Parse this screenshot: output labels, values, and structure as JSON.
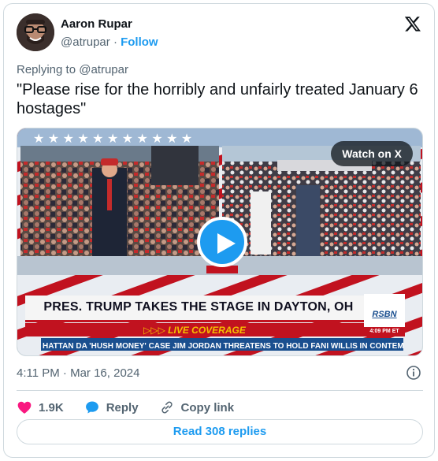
{
  "author": {
    "name": "Aaron Rupar",
    "handle": "@atrupar",
    "separator": "·",
    "follow_label": "Follow"
  },
  "reply_context": "Replying to @atrupar",
  "tweet_text": "\"Please rise for the horribly and unfairly treated January 6 hostages\"",
  "media": {
    "watch_label": "Watch on X",
    "headline": "PRES. TRUMP TAKES THE STAGE IN DAYTON, OH",
    "live_label": "▷▷▷ LIVE COVERAGE",
    "ticker": "HATTAN DA 'HUSH MONEY' CASE    JIM JORDAN THREATENS TO HOLD FANI WILLIS IN CONTEMPT",
    "network_logo": "RSBN",
    "network_time": "4:09 PM ET"
  },
  "timestamp": "4:11 PM · Mar 16, 2024",
  "actions": {
    "like_count": "1.9K",
    "reply_label": "Reply",
    "copy_link_label": "Copy link"
  },
  "read_replies_label": "Read 308 replies",
  "colors": {
    "accent": "#1d9bf0",
    "like": "#f91880",
    "muted_text": "#536471",
    "border": "#cfd9de"
  }
}
